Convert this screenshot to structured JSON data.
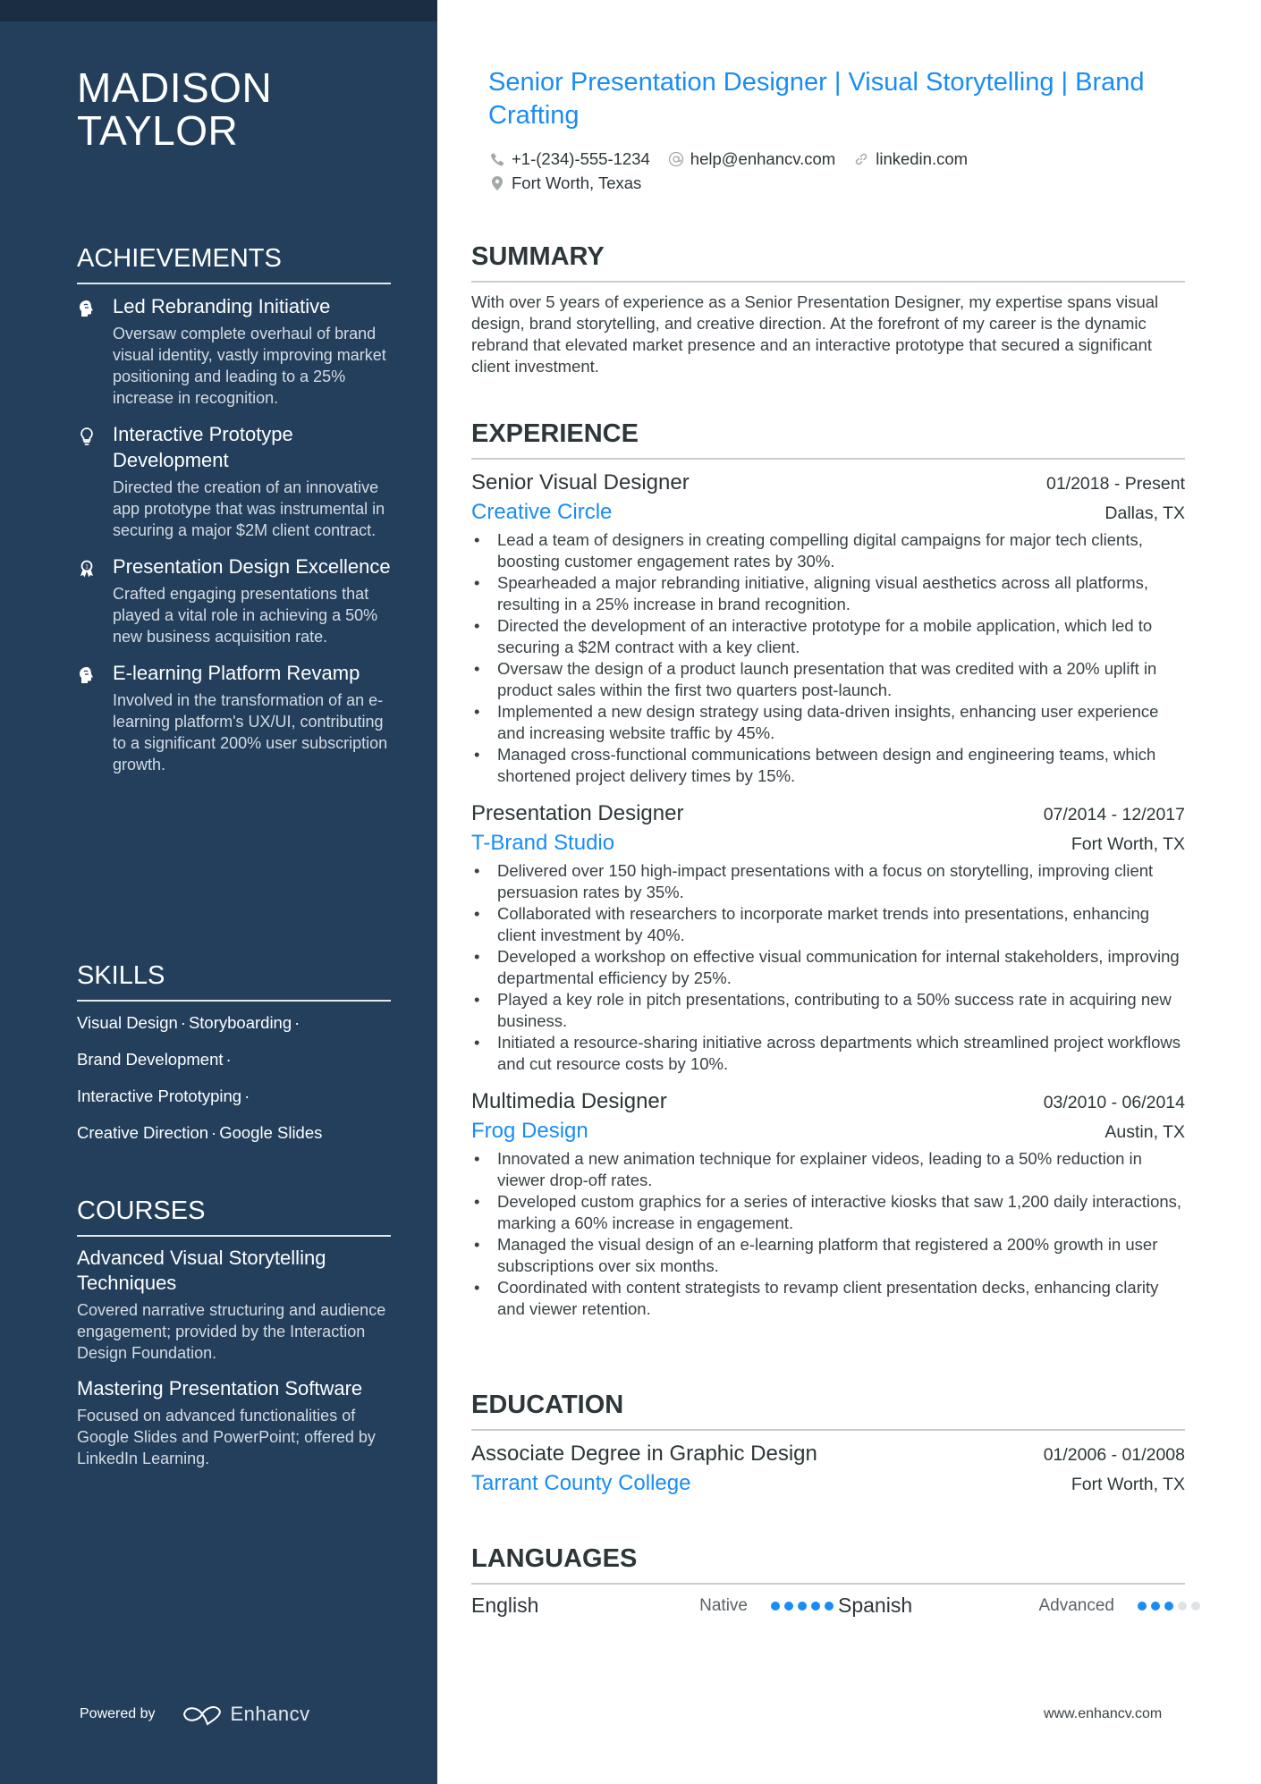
{
  "name": "MADISON TAYLOR",
  "title": "Senior Presentation Designer | Visual Storytelling | Brand Crafting",
  "colors": {
    "sidebar": "#233f5c",
    "accent": "#1a8cf5",
    "text": "#2d3639"
  },
  "contacts": [
    {
      "icon": "phone-icon",
      "text": "+1-(234)-555-1234"
    },
    {
      "icon": "at-icon",
      "text": "help@enhancv.com"
    },
    {
      "icon": "link-icon",
      "text": "linkedin.com"
    },
    {
      "icon": "location-pin-icon",
      "text": "Fort Worth, Texas"
    }
  ],
  "achievements": {
    "heading": "ACHIEVEMENTS",
    "items": [
      {
        "icon": "head-brain-icon",
        "title": "Led Rebranding Initiative",
        "desc": "Oversaw complete overhaul of brand visual identity, vastly improving market positioning and leading to a 25% increase in recognition."
      },
      {
        "icon": "lightbulb-icon",
        "title": "Interactive Prototype Development",
        "desc": "Directed the creation of an innovative app prototype that was instrumental in securing a major $2M client contract."
      },
      {
        "icon": "award-medal-icon",
        "title": "Presentation Design Excellence",
        "desc": "Crafted engaging presentations that played a vital role in achieving a 50% new business acquisition rate."
      },
      {
        "icon": "head-brain-icon",
        "title": "E-learning Platform Revamp",
        "desc": "Involved in the transformation of an e-learning platform's UX/UI, contributing to a significant 200% user subscription growth."
      }
    ]
  },
  "skills": {
    "heading": "SKILLS",
    "lines": [
      [
        "Visual Design",
        "Storyboarding"
      ],
      [
        "Brand Development"
      ],
      [
        "Interactive Prototyping"
      ],
      [
        "Creative Direction",
        "Google Slides"
      ]
    ],
    "separator": "·"
  },
  "courses": {
    "heading": "COURSES",
    "items": [
      {
        "title": "Advanced Visual Storytelling Techniques",
        "desc": "Covered narrative structuring and audience engagement; provided by the Interaction Design Foundation."
      },
      {
        "title": "Mastering Presentation Software",
        "desc": "Focused on advanced functionalities of Google Slides and PowerPoint; offered by LinkedIn Learning."
      }
    ]
  },
  "powered_by": {
    "label": "Powered by",
    "brand": "Enhancv"
  },
  "summary": {
    "heading": "SUMMARY",
    "text": "With over 5 years of experience as a Senior Presentation Designer, my expertise spans visual design, brand storytelling, and creative direction. At the forefront of my career is the dynamic rebrand that elevated market presence and an interactive prototype that secured a significant client investment."
  },
  "experience": {
    "heading": "EXPERIENCE",
    "jobs": [
      {
        "title": "Senior Visual Designer",
        "dates": "01/2018 - Present",
        "company": "Creative Circle",
        "location": "Dallas, TX",
        "bullets": [
          "Lead a team of designers in creating compelling digital campaigns for major tech clients, boosting customer engagement rates by 30%.",
          "Spearheaded a major rebranding initiative, aligning visual aesthetics across all platforms, resulting in a 25% increase in brand recognition.",
          "Directed the development of an interactive prototype for a mobile application, which led to securing a $2M contract with a key client.",
          "Oversaw the design of a product launch presentation that was credited with a 20% uplift in product sales within the first two quarters post-launch.",
          "Implemented a new design strategy using data-driven insights, enhancing user experience and increasing website traffic by 45%.",
          "Managed cross-functional communications between design and engineering teams, which shortened project delivery times by 15%."
        ]
      },
      {
        "title": "Presentation Designer",
        "dates": "07/2014 - 12/2017",
        "company": "T-Brand Studio",
        "location": "Fort Worth, TX",
        "bullets": [
          "Delivered over 150 high-impact presentations with a focus on storytelling, improving client persuasion rates by 35%.",
          "Collaborated with researchers to incorporate market trends into presentations, enhancing client investment by 40%.",
          "Developed a workshop on effective visual communication for internal stakeholders, improving departmental efficiency by 25%.",
          "Played a key role in pitch presentations, contributing to a 50% success rate in acquiring new business.",
          "Initiated a resource-sharing initiative across departments which streamlined project workflows and cut resource costs by 10%."
        ]
      },
      {
        "title": "Multimedia Designer",
        "dates": "03/2010 - 06/2014",
        "company": "Frog Design",
        "location": "Austin, TX",
        "bullets": [
          "Innovated a new animation technique for explainer videos, leading to a 50% reduction in viewer drop-off rates.",
          "Developed custom graphics for a series of interactive kiosks that saw 1,200 daily interactions, marking a 60% increase in engagement.",
          "Managed the visual design of an e-learning platform that registered a 200% growth in user subscriptions over six months.",
          "Coordinated with content strategists to revamp client presentation decks, enhancing clarity and viewer retention."
        ]
      }
    ]
  },
  "education": {
    "heading": "EDUCATION",
    "items": [
      {
        "degree": "Associate Degree in Graphic Design",
        "dates": "01/2006 - 01/2008",
        "school": "Tarrant County College",
        "location": "Fort Worth, TX"
      }
    ]
  },
  "languages": {
    "heading": "LANGUAGES",
    "items": [
      {
        "name": "English",
        "level": "Native",
        "rating": 5,
        "max": 5
      },
      {
        "name": "Spanish",
        "level": "Advanced",
        "rating": 3,
        "max": 5
      }
    ]
  },
  "footer_url": "www.enhancv.com"
}
